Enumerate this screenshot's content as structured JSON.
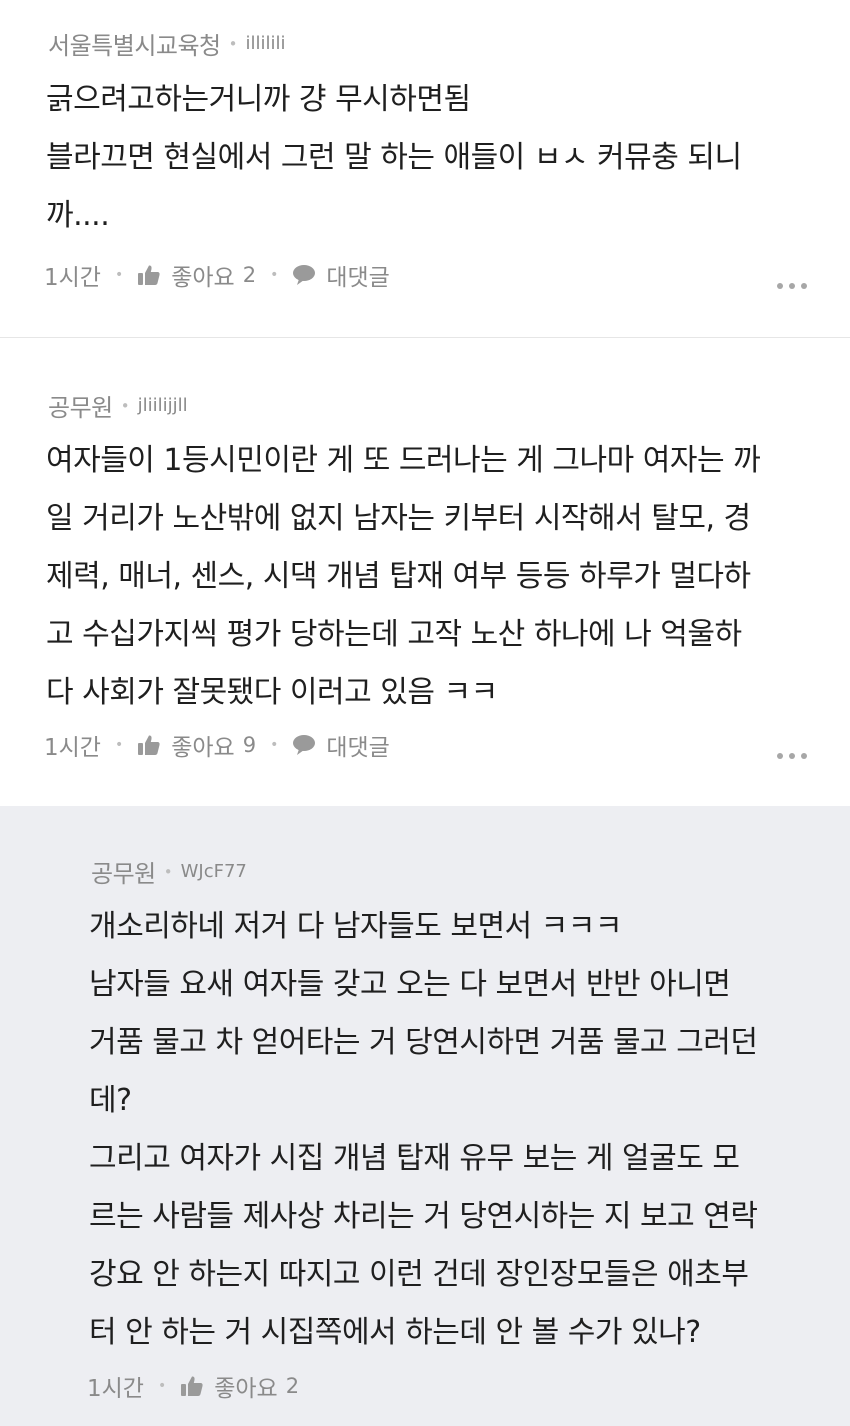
{
  "comments": [
    {
      "author": "서울특별시교육청",
      "user_id": "illilili",
      "lines": [
        "긁으려고하는거니까 걍 무시하면됨",
        "블라끄면 현실에서 그런 말 하는 애들이 ㅂㅅ 커뮤충 되니",
        "까...."
      ],
      "time": "1시간",
      "like_label": "좋아요",
      "like_count": "2",
      "reply_label": "대댓글"
    },
    {
      "author": "공무원",
      "user_id": "jliilijjll",
      "lines": [
        "여자들이 1등시민이란 게 또 드러나는 게 그나마 여자는 까",
        "일 거리가 노산밖에 없지 남자는 키부터 시작해서 탈모, 경",
        "제력, 매너, 센스, 시댁 개념 탑재 여부 등등 하루가 멀다하",
        "고 수십가지씩 평가 당하는데 고작 노산 하나에 나 억울하",
        "다 사회가 잘못됐다 이러고 있음 ㅋㅋ"
      ],
      "time": "1시간",
      "like_label": "좋아요",
      "like_count": "9",
      "reply_label": "대댓글"
    },
    {
      "author": "공무원",
      "user_id": "WJcF77",
      "lines": [
        "개소리하네 저거 다 남자들도 보면서 ㅋㅋㅋ",
        "남자들 요새 여자들 갖고 오는 다 보면서 반반 아니면",
        "거품 물고 차 얻어타는 거 당연시하면 거품 물고 그러던",
        "데?",
        "그리고 여자가 시집 개념 탑재 유무 보는 게 얼굴도 모",
        "르는 사람들 제사상 차리는 거 당연시하는 지 보고 연락",
        "강요 안 하는지 따지고 이런 건데 장인장모들은 애초부",
        "터 안 하는 거 시집쪽에서 하는데 안 볼 수가 있나?"
      ],
      "time": "1시간",
      "like_label": "좋아요",
      "like_count": "2"
    }
  ],
  "icons": {
    "like": "thumbs-up-icon",
    "reply": "speech-bubble-icon",
    "more": "more-dots-icon"
  },
  "colors": {
    "reply_background": "#edeef2",
    "meta_text": "#8a8a8a",
    "body_text": "#1f1f1f"
  }
}
